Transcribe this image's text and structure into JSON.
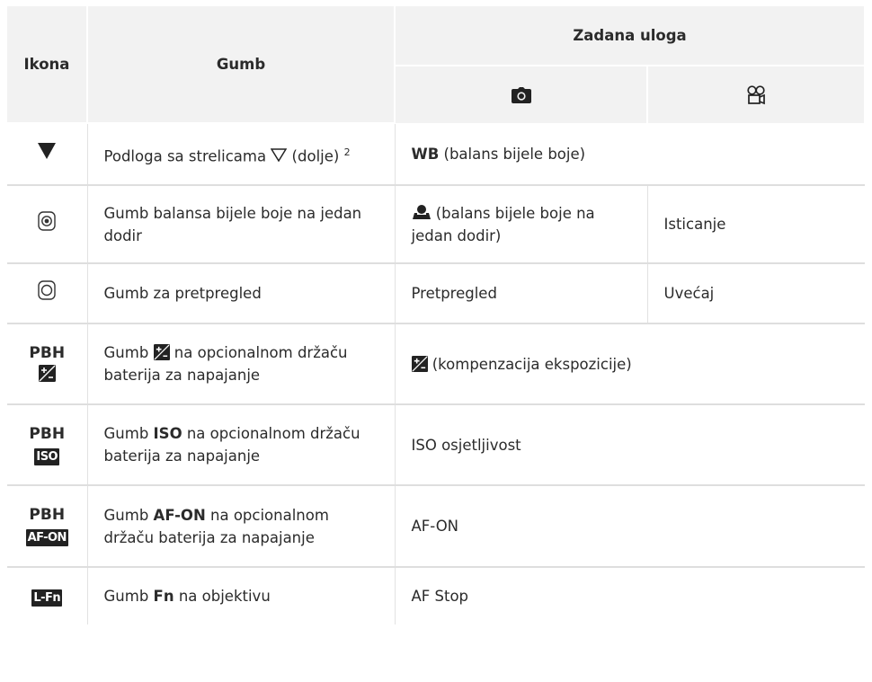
{
  "header": {
    "col_icon": "Ikona",
    "col_button": "Gumb",
    "col_default": "Zadana uloga",
    "photo_icon": "camera-icon",
    "video_icon": "movie-icon"
  },
  "rows": [
    {
      "icon": "down-triangle-icon",
      "button": [
        "Podloga sa strelicama ",
        " (dolje) ",
        "2"
      ],
      "role_both": [
        "WB",
        " (balans bijele boje)"
      ]
    },
    {
      "icon": "one-touch-wb-icon",
      "button": [
        "Gumb balansa bijele boje na jedan dodir"
      ],
      "role_photo": [
        "(balans bijele boje na jedan dodir)"
      ],
      "role_video": "Isticanje"
    },
    {
      "icon": "preview-icon",
      "button": [
        "Gumb za pretpregled"
      ],
      "role_photo": [
        "Pretpregled"
      ],
      "role_video": "Uvećaj"
    },
    {
      "icon_text": "PBH",
      "button": [
        "Gumb ",
        " na opcionalnom držaču baterija za napajanje"
      ],
      "role_both": [
        "(kompenzacija ekspozicije)"
      ]
    },
    {
      "icon_text": "PBH",
      "icon_badge": "ISO",
      "button": [
        "Gumb ",
        "ISO",
        " na opcionalnom držaču baterija za napajanje"
      ],
      "role_both": [
        "ISO osjetljivost"
      ]
    },
    {
      "icon_text": "PBH",
      "icon_badge": "AF-ON",
      "button": [
        "Gumb ",
        "AF-ON",
        " na opcionalnom držaču baterija za napajanje"
      ],
      "role_both": [
        "AF-ON"
      ]
    },
    {
      "icon_badge": "L-Fn",
      "button": [
        "Gumb ",
        "Fn",
        " na objektivu"
      ],
      "role_both": [
        "AF Stop"
      ]
    }
  ]
}
